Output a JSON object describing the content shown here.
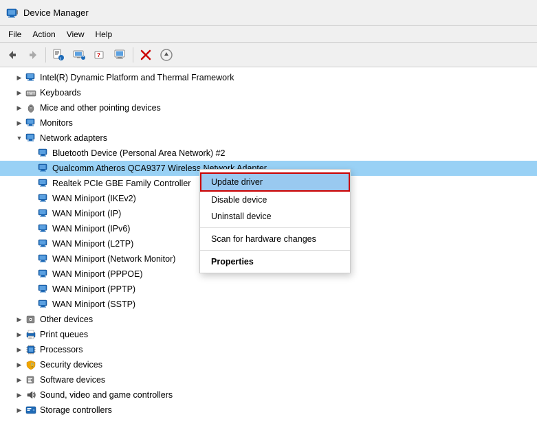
{
  "titleBar": {
    "title": "Device Manager",
    "icon": "computer-manager-icon"
  },
  "menuBar": {
    "items": [
      {
        "id": "file",
        "label": "File"
      },
      {
        "id": "action",
        "label": "Action"
      },
      {
        "id": "view",
        "label": "View"
      },
      {
        "id": "help",
        "label": "Help"
      }
    ]
  },
  "toolbar": {
    "buttons": [
      {
        "id": "back",
        "icon": "◄",
        "label": "Back"
      },
      {
        "id": "forward",
        "icon": "►",
        "label": "Forward"
      },
      {
        "id": "properties",
        "icon": "📋",
        "label": "Properties"
      },
      {
        "id": "update-driver",
        "icon": "🖥",
        "label": "Update Driver"
      },
      {
        "id": "uninstall",
        "icon": "❓",
        "label": "Uninstall"
      },
      {
        "id": "scan",
        "icon": "📺",
        "label": "Scan"
      },
      {
        "id": "delete",
        "icon": "✖",
        "label": "Delete"
      },
      {
        "id": "download",
        "icon": "⊕",
        "label": "Download"
      }
    ]
  },
  "treeItems": [
    {
      "id": "intel-thermal",
      "label": "Intel(R) Dynamic Platform and Thermal Framework",
      "indent": 1,
      "expanded": false,
      "icon": "monitor-icon",
      "type": "category"
    },
    {
      "id": "keyboards",
      "label": "Keyboards",
      "indent": 1,
      "expanded": false,
      "icon": "keyboard-icon",
      "type": "category"
    },
    {
      "id": "mice",
      "label": "Mice and other pointing devices",
      "indent": 1,
      "expanded": false,
      "icon": "mouse-icon",
      "type": "category"
    },
    {
      "id": "monitors",
      "label": "Monitors",
      "indent": 1,
      "expanded": false,
      "icon": "monitor-icon",
      "type": "category"
    },
    {
      "id": "network-adapters",
      "label": "Network adapters",
      "indent": 1,
      "expanded": true,
      "icon": "network-icon",
      "type": "category"
    },
    {
      "id": "bluetooth",
      "label": "Bluetooth Device (Personal Area Network) #2",
      "indent": 2,
      "expanded": false,
      "icon": "network-adapter-icon",
      "type": "device"
    },
    {
      "id": "qualcomm",
      "label": "Qualcomm Atheros QCA9377 Wireless Network Adapter",
      "indent": 2,
      "expanded": false,
      "icon": "network-adapter-icon",
      "type": "device",
      "selected": true
    },
    {
      "id": "realtek",
      "label": "Realtek PCIe GBE Family Controller",
      "indent": 2,
      "expanded": false,
      "icon": "network-adapter-icon",
      "type": "device"
    },
    {
      "id": "wan-ikev2",
      "label": "WAN Miniport (IKEv2)",
      "indent": 2,
      "expanded": false,
      "icon": "network-adapter-icon",
      "type": "device"
    },
    {
      "id": "wan-ip",
      "label": "WAN Miniport (IP)",
      "indent": 2,
      "expanded": false,
      "icon": "network-adapter-icon",
      "type": "device"
    },
    {
      "id": "wan-ipv6",
      "label": "WAN Miniport (IPv6)",
      "indent": 2,
      "expanded": false,
      "icon": "network-adapter-icon",
      "type": "device"
    },
    {
      "id": "wan-l2tp",
      "label": "WAN Miniport (L2TP)",
      "indent": 2,
      "expanded": false,
      "icon": "network-adapter-icon",
      "type": "device"
    },
    {
      "id": "wan-netmon",
      "label": "WAN Miniport (Network Monitor)",
      "indent": 2,
      "expanded": false,
      "icon": "network-adapter-icon",
      "type": "device"
    },
    {
      "id": "wan-pppoe",
      "label": "WAN Miniport (PPPOE)",
      "indent": 2,
      "expanded": false,
      "icon": "network-adapter-icon",
      "type": "device"
    },
    {
      "id": "wan-pptp",
      "label": "WAN Miniport (PPTP)",
      "indent": 2,
      "expanded": false,
      "icon": "network-adapter-icon",
      "type": "device"
    },
    {
      "id": "wan-sstp",
      "label": "WAN Miniport (SSTP)",
      "indent": 2,
      "expanded": false,
      "icon": "network-adapter-icon",
      "type": "device"
    },
    {
      "id": "other-devices",
      "label": "Other devices",
      "indent": 1,
      "expanded": false,
      "icon": "other-icon",
      "type": "category"
    },
    {
      "id": "print-queues",
      "label": "Print queues",
      "indent": 1,
      "expanded": false,
      "icon": "print-icon",
      "type": "category"
    },
    {
      "id": "processors",
      "label": "Processors",
      "indent": 1,
      "expanded": false,
      "icon": "processor-icon",
      "type": "category"
    },
    {
      "id": "security-devices",
      "label": "Security devices",
      "indent": 1,
      "expanded": false,
      "icon": "security-icon",
      "type": "category"
    },
    {
      "id": "software-devices",
      "label": "Software devices",
      "indent": 1,
      "expanded": false,
      "icon": "software-icon",
      "type": "category"
    },
    {
      "id": "sound",
      "label": "Sound, video and game controllers",
      "indent": 1,
      "expanded": false,
      "icon": "sound-icon",
      "type": "category"
    },
    {
      "id": "storage",
      "label": "Storage controllers",
      "indent": 1,
      "expanded": false,
      "icon": "storage-icon",
      "type": "category"
    }
  ],
  "contextMenu": {
    "visible": true,
    "items": [
      {
        "id": "update-driver",
        "label": "Update driver",
        "bold": false,
        "active": true
      },
      {
        "id": "disable-device",
        "label": "Disable device",
        "bold": false
      },
      {
        "id": "uninstall-device",
        "label": "Uninstall device",
        "bold": false
      },
      {
        "id": "separator1",
        "type": "separator"
      },
      {
        "id": "scan-hardware",
        "label": "Scan for hardware changes",
        "bold": false
      },
      {
        "id": "separator2",
        "type": "separator"
      },
      {
        "id": "properties",
        "label": "Properties",
        "bold": true
      }
    ]
  }
}
